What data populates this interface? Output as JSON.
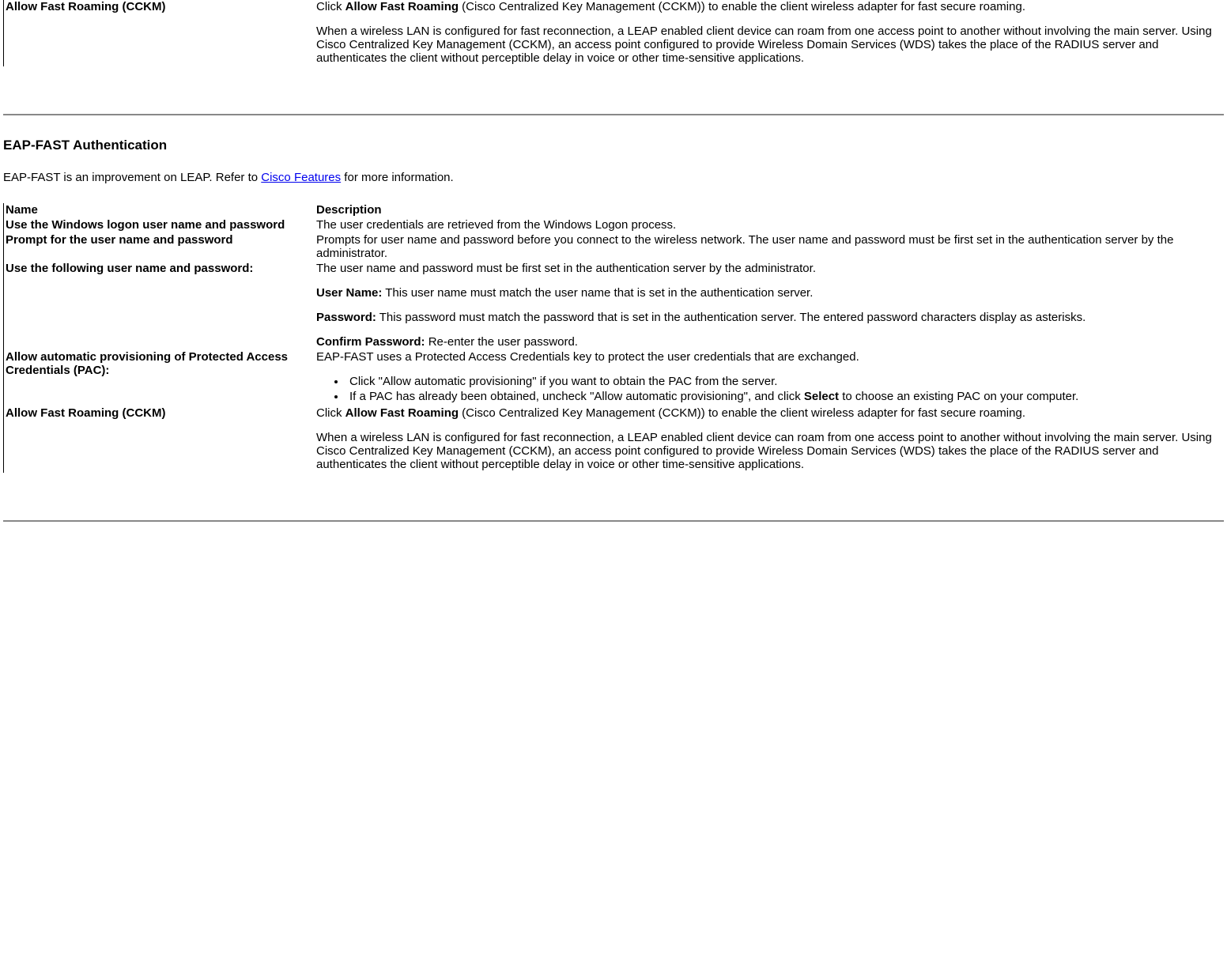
{
  "section1": {
    "row_name": "Allow Fast Roaming (CCKM)",
    "p1_pre": "Click ",
    "p1_bold": "Allow Fast Roaming",
    "p1_post": " (Cisco Centralized Key Management (CCKM)) to enable the client wireless adapter for fast secure roaming.",
    "p2": "When a wireless LAN is configured for fast reconnection, a LEAP enabled client device can roam from one access point to another without involving the main server. Using Cisco Centralized Key Management (CCKM), an access point configured to provide Wireless Domain Services (WDS) takes the place of the RADIUS server and authenticates the client without perceptible delay in voice or other time-sensitive applications."
  },
  "section2": {
    "heading": "EAP-FAST Authentication",
    "intro_pre": "EAP-FAST is an improvement on LEAP. Refer to ",
    "intro_link": "Cisco Features",
    "intro_post": " for more information.",
    "header_name": "Name",
    "header_desc": "Description",
    "rows": [
      {
        "name": "Use the Windows logon user name and password",
        "desc_text": "The user credentials are retrieved from the Windows Logon process."
      },
      {
        "name": "Prompt for the user name and password",
        "desc_text": "Prompts for user name and password before you connect to the wireless network. The user name and password must be first set in the authentication server by the administrator."
      }
    ],
    "row_usefollowing": {
      "name": "Use the following user name and password:",
      "p1": "The user name and password must be first set in the authentication server by the administrator.",
      "un_label": "User Name:",
      "un_text": " This user name must match the user name that is set in the authentication server.",
      "pw_label": "Password:",
      "pw_text": " This password must match the password that is set in the authentication server. The entered password characters display as asterisks.",
      "cpw_label": "Confirm Password:",
      "cpw_text": " Re-enter the user password."
    },
    "row_allowauto": {
      "name": "Allow automatic provisioning of Protected Access Credentials (PAC):",
      "p1": "EAP-FAST uses a Protected Access Credentials key to protect the user credentials that are exchanged.",
      "li1": "Click \"Allow automatic provisioning\" if you want to obtain the PAC from the server.",
      "li2_pre": "If a PAC has already been obtained, uncheck  \"Allow automatic provisioning\", and  click ",
      "li2_bold": "Select",
      "li2_post": " to choose an existing PAC on your computer."
    },
    "row_allowfast": {
      "name": "Allow Fast Roaming (CCKM)",
      "p1_pre": "Click ",
      "p1_bold": "Allow Fast Roaming",
      "p1_post": " (Cisco Centralized Key Management (CCKM)) to enable the client wireless adapter for fast secure roaming.",
      "p2": "When a wireless LAN is configured for fast reconnection, a LEAP enabled client device can roam from one access point to another without involving the main server. Using Cisco Centralized Key Management (CCKM), an access point configured to provide Wireless Domain Services (WDS) takes the place of the RADIUS server and authenticates the client without perceptible delay in voice or other time-sensitive applications."
    }
  }
}
